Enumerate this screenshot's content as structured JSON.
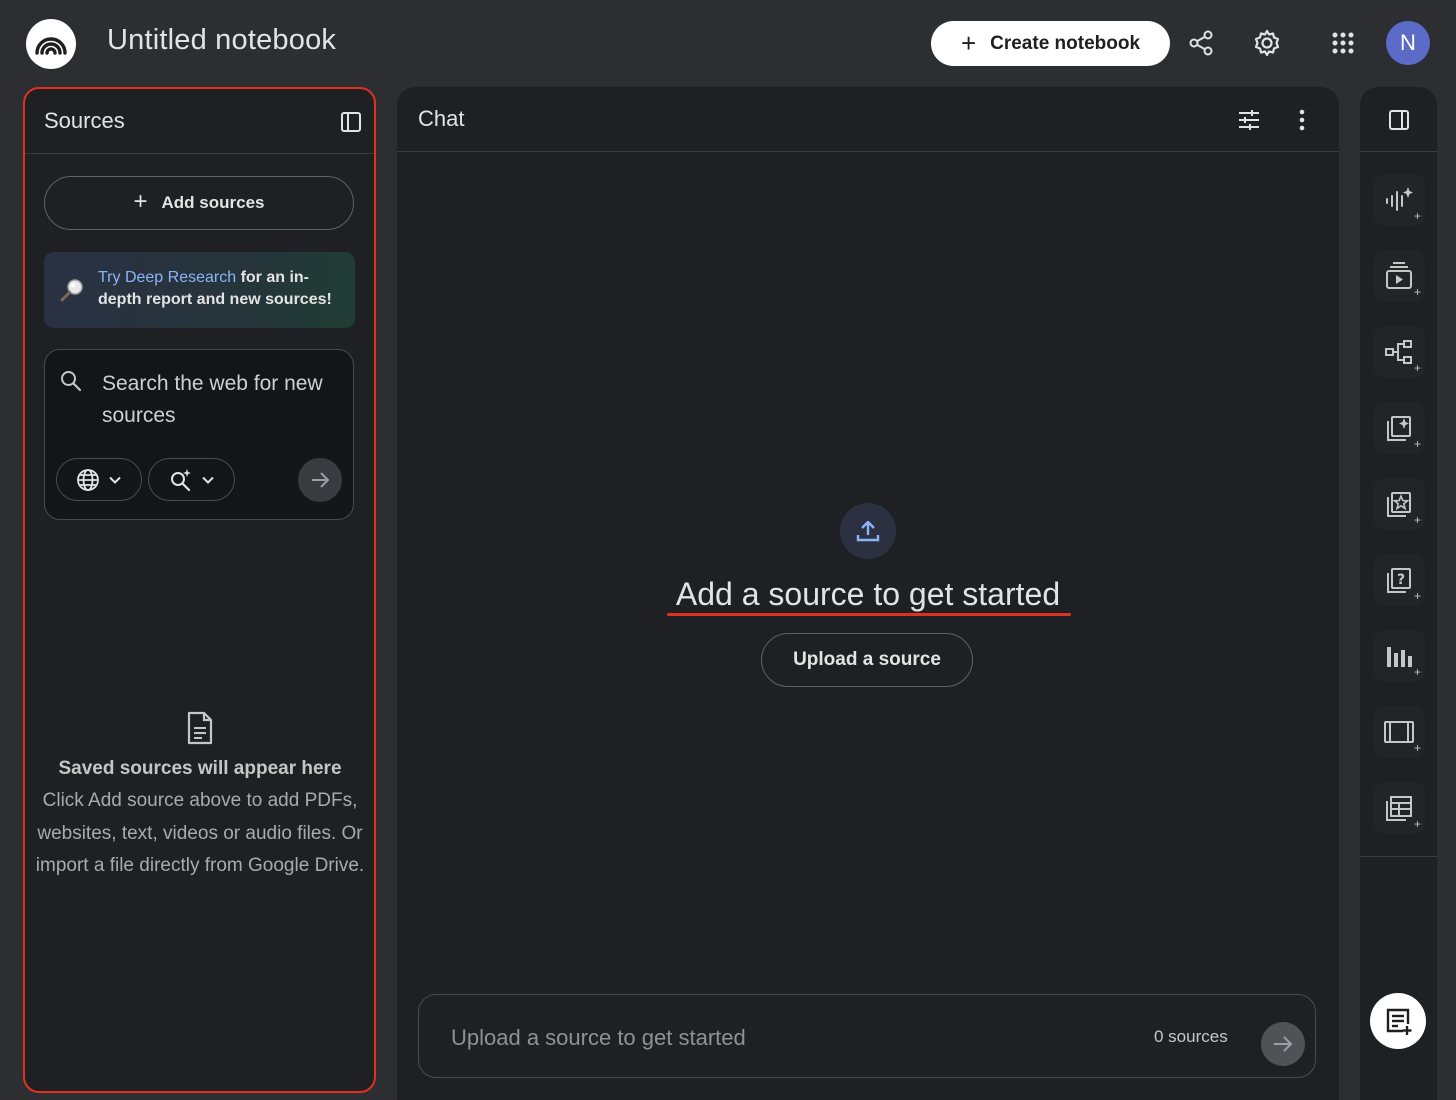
{
  "header": {
    "title": "Untitled notebook",
    "create_label": "Create notebook",
    "avatar_initial": "N",
    "icons": [
      "notebooklm-logo-icon",
      "share-icon",
      "settings-gear-icon",
      "apps-grid-icon"
    ]
  },
  "sources": {
    "title": "Sources",
    "add_label": "Add sources",
    "deep_research": {
      "link": "Try Deep Research",
      "rest": " for an in-depth report and new sources!"
    },
    "search": {
      "placeholder": "Search the web for new sources"
    },
    "empty": {
      "title": "Saved sources will appear here",
      "description": "Click Add source above to add PDFs, websites, text, videos or audio files. Or import a file directly from Google Drive."
    }
  },
  "chat": {
    "title": "Chat",
    "headline": "Add a source to get started",
    "upload_label": "Upload a source",
    "input_placeholder": "Upload a source to get started",
    "sources_count": "0 sources"
  },
  "studio": {
    "tools": [
      "audio-overview-icon",
      "video-overview-icon",
      "mind-map-icon",
      "reports-icon",
      "flashcards-icon",
      "quiz-icon",
      "infographic-icon",
      "slide-deck-icon",
      "data-table-icon"
    ]
  },
  "colors": {
    "background": "#2d2e31",
    "panel": "#1f2024",
    "highlight_border": "#e0301e",
    "link": "#8ab4f8",
    "avatar": "#5b6bc7"
  }
}
